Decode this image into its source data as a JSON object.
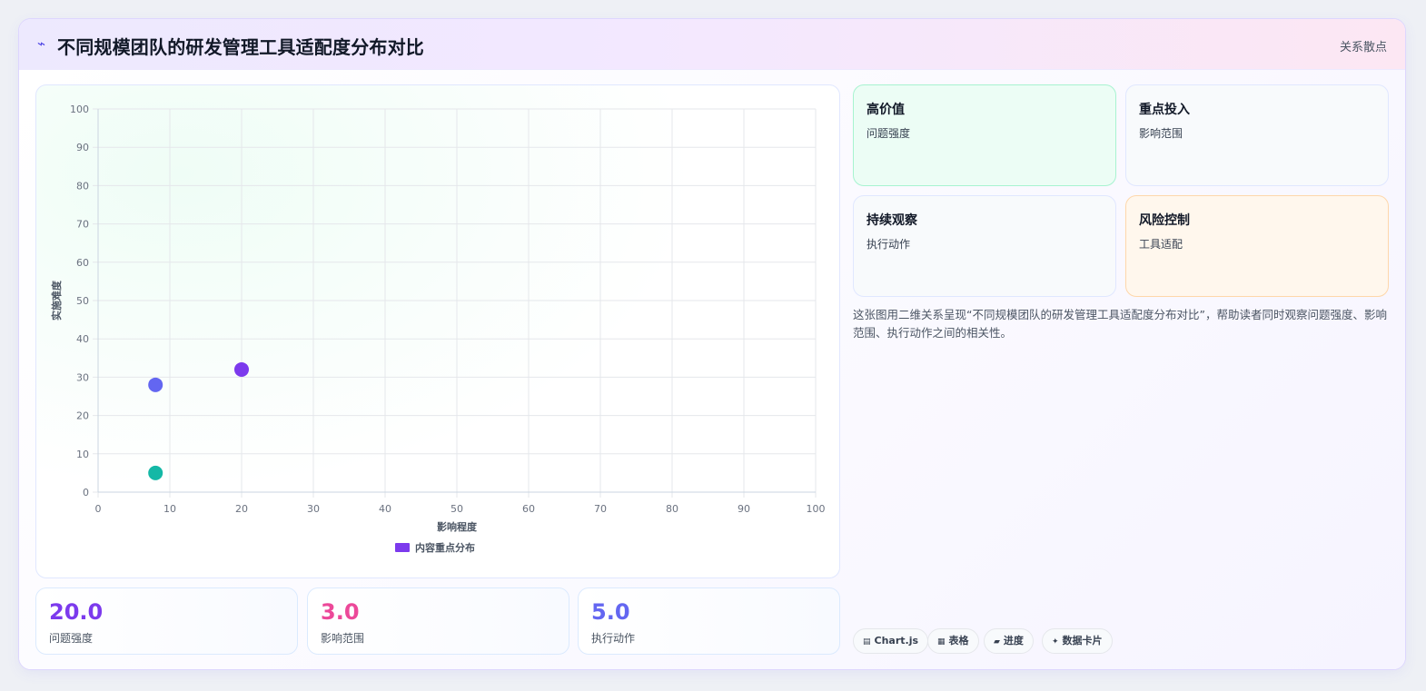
{
  "header": {
    "title": "不同规模团队的研发管理工具适配度分布对比",
    "tag": "关系散点"
  },
  "chart_data": {
    "type": "scatter",
    "xlabel": "影响程度",
    "ylabel": "实施难度",
    "xlim": [
      0,
      100
    ],
    "ylim": [
      0,
      100
    ],
    "xticks": [
      0,
      10,
      20,
      30,
      40,
      50,
      60,
      70,
      80,
      90,
      100
    ],
    "yticks": [
      0,
      10,
      20,
      30,
      40,
      50,
      60,
      70,
      80,
      90,
      100
    ],
    "grid": true,
    "legend_position": "bottom",
    "series": [
      {
        "name": "内容重点分布",
        "color": "#7c3aed",
        "points": [
          {
            "x": 20,
            "y": 32,
            "color": "#7c3aed"
          },
          {
            "x": 8,
            "y": 28,
            "color": "#6366f1"
          },
          {
            "x": 8,
            "y": 5,
            "color": "#14b8a6"
          }
        ]
      }
    ]
  },
  "stats": [
    {
      "value": "20.0",
      "label": "问题强度",
      "color": "#7c3aed"
    },
    {
      "value": "3.0",
      "label": "影响范围",
      "color": "#ec4899"
    },
    {
      "value": "5.0",
      "label": "执行动作",
      "color": "#6366f1"
    }
  ],
  "quadrants": [
    {
      "title": "高价值",
      "subtitle": "问题强度",
      "bg": "#ecfdf5",
      "border": "#a7f3d0"
    },
    {
      "title": "重点投入",
      "subtitle": "影响范围",
      "bg": "#f8fafc",
      "border": "#e0e7ff"
    },
    {
      "title": "持续观察",
      "subtitle": "执行动作",
      "bg": "#f8fafc",
      "border": "#e0e7ff"
    },
    {
      "title": "风险控制",
      "subtitle": "工具适配",
      "bg": "#fff7ed",
      "border": "#fed7aa"
    }
  ],
  "description": "这张图用二维关系呈现“不同规模团队的研发管理工具适配度分布对比”，帮助读者同时观察问题强度、影响范围、执行动作之间的相关性。",
  "chips": [
    {
      "icon": "▤",
      "label": "Chart.js"
    },
    {
      "icon": "▦",
      "label": "表格"
    },
    {
      "icon": "▰",
      "label": "进度"
    },
    {
      "icon": "✦",
      "label": "数据卡片"
    }
  ]
}
